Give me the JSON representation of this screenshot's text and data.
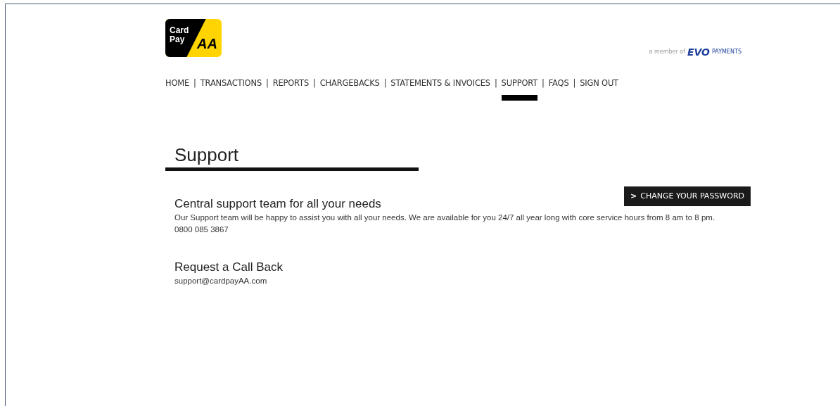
{
  "logo": {
    "line_1": "Card",
    "line_2": "Pay",
    "brand": "AA"
  },
  "partner": {
    "prefix": "a member of",
    "brand": "EVO",
    "sub": "PAYMENTS"
  },
  "nav": [
    {
      "kind": "link",
      "label": "HOME",
      "selected": false
    },
    {
      "kind": "separator",
      "text": "|"
    },
    {
      "kind": "link",
      "label": "TRANSACTIONS",
      "selected": false
    },
    {
      "kind": "separator",
      "text": "|"
    },
    {
      "kind": "link",
      "label": "REPORTS",
      "selected": false
    },
    {
      "kind": "separator",
      "text": "|"
    },
    {
      "kind": "link",
      "label": "CHARGEBACKS",
      "selected": false
    },
    {
      "kind": "separator",
      "text": "|"
    },
    {
      "kind": "link",
      "label": "STATEMENTS & INVOICES",
      "selected": false
    },
    {
      "kind": "separator",
      "text": "|"
    },
    {
      "kind": "link",
      "label": "SUPPORT",
      "selected": true
    },
    {
      "kind": "separator",
      "text": "|"
    },
    {
      "kind": "link",
      "label": "FAQS",
      "selected": false
    },
    {
      "kind": "separator",
      "text": "|"
    },
    {
      "kind": "link",
      "label": "SIGN OUT",
      "selected": false
    }
  ],
  "page_title": "Support",
  "password_button": {
    "icon": ">",
    "label": "CHANGE YOUR PASSWORD"
  },
  "sections": [
    {
      "heading": "Central support team for all your needs",
      "lines": [
        "Our Support team will be happy to assist you with all your needs. We are available for you 24/7 all year long with core service hours from 8 am to 8 pm.",
        "0800 085 3867"
      ]
    },
    {
      "heading": "Request a Call Back",
      "lines": [
        "support@cardpayAA.com"
      ]
    }
  ]
}
